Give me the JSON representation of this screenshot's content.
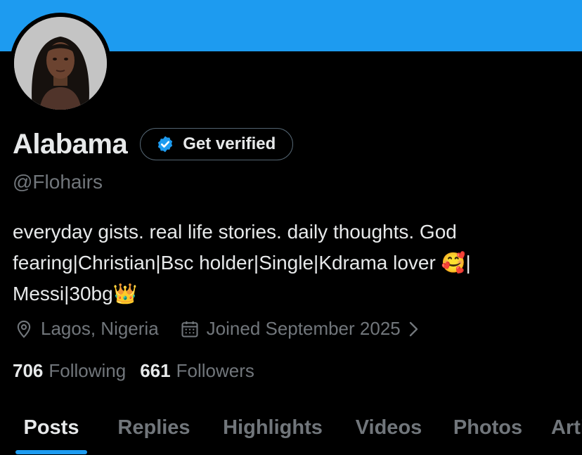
{
  "profile": {
    "display_name": "Alabama",
    "handle": "@Flohairs",
    "verify_button_label": "Get verified",
    "bio_lines": [
      "everyday gists. real life stories. daily thoughts. God",
      "fearing|Christian|Bsc holder|Single|Kdrama lover 🥰|",
      "Messi|30bg👑"
    ],
    "location": "Lagos, Nigeria",
    "joined": "Joined September 2025",
    "following_count": "706",
    "following_label": "Following",
    "followers_count": "661",
    "followers_label": "Followers"
  },
  "tabs": [
    {
      "label": "Posts",
      "active": true
    },
    {
      "label": "Replies",
      "active": false
    },
    {
      "label": "Highlights",
      "active": false
    },
    {
      "label": "Videos",
      "active": false
    },
    {
      "label": "Photos",
      "active": false
    },
    {
      "label": "Articles",
      "active": false
    }
  ],
  "icons": {
    "verified": "verified-badge-icon",
    "location": "location-pin-icon",
    "calendar": "calendar-icon",
    "chevron": "chevron-right-icon"
  },
  "colors": {
    "accent": "#1d9bf0",
    "background": "#000000",
    "text_primary": "#e7e9ea",
    "text_secondary": "#71767b"
  }
}
